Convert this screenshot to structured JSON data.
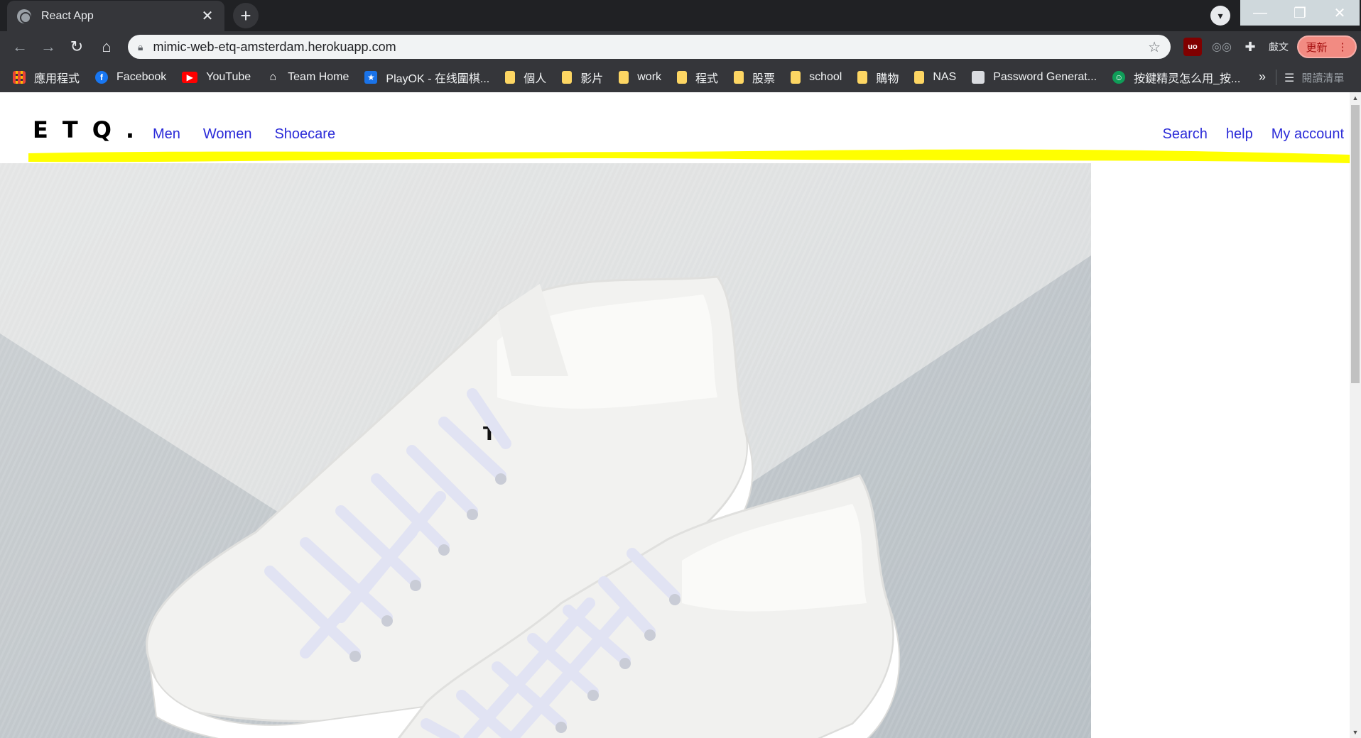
{
  "browser": {
    "tab_title": "React App",
    "tab_close": "✕",
    "new_tab": "+",
    "window_min": "—",
    "window_max": "❐",
    "window_close": "✕",
    "url": "mimic-web-etq-amsterdam.herokuapp.com",
    "update_label": "更新",
    "update_menu": "⋮",
    "translate_label": "㪥文",
    "ublock_label": "uo",
    "bookmarks": [
      {
        "label": "應用程式",
        "icon": "apps-grid-icon"
      },
      {
        "label": "Facebook",
        "icon": "facebook-icon"
      },
      {
        "label": "YouTube",
        "icon": "youtube-icon"
      },
      {
        "label": "Team Home",
        "icon": "team-home-icon"
      },
      {
        "label": "PlayOK - 在线圍棋...",
        "icon": "playok-icon"
      },
      {
        "label": "個人",
        "icon": "folder-icon"
      },
      {
        "label": "影片",
        "icon": "folder-icon"
      },
      {
        "label": "work",
        "icon": "folder-icon"
      },
      {
        "label": "程式",
        "icon": "folder-icon"
      },
      {
        "label": "股票",
        "icon": "folder-icon"
      },
      {
        "label": "school",
        "icon": "folder-icon"
      },
      {
        "label": "購物",
        "icon": "folder-icon"
      },
      {
        "label": "NAS",
        "icon": "folder-icon"
      },
      {
        "label": "Password Generat...",
        "icon": "page-icon"
      },
      {
        "label": "按鍵精灵怎么用_按...",
        "icon": "key-sprite-icon"
      }
    ],
    "bookmarks_more": "»",
    "reading_list_label": "閱讀清單"
  },
  "site": {
    "logo": "ETQ.",
    "nav_left": [
      "Men",
      "Women",
      "Shoecare"
    ],
    "nav_right": [
      "Search",
      "help",
      "My account"
    ],
    "highlight_color": "#ffff00",
    "link_color": "#2b2bd8"
  },
  "hero": {
    "subject": "white-sneakers-photo",
    "tongue_logo": "T"
  }
}
